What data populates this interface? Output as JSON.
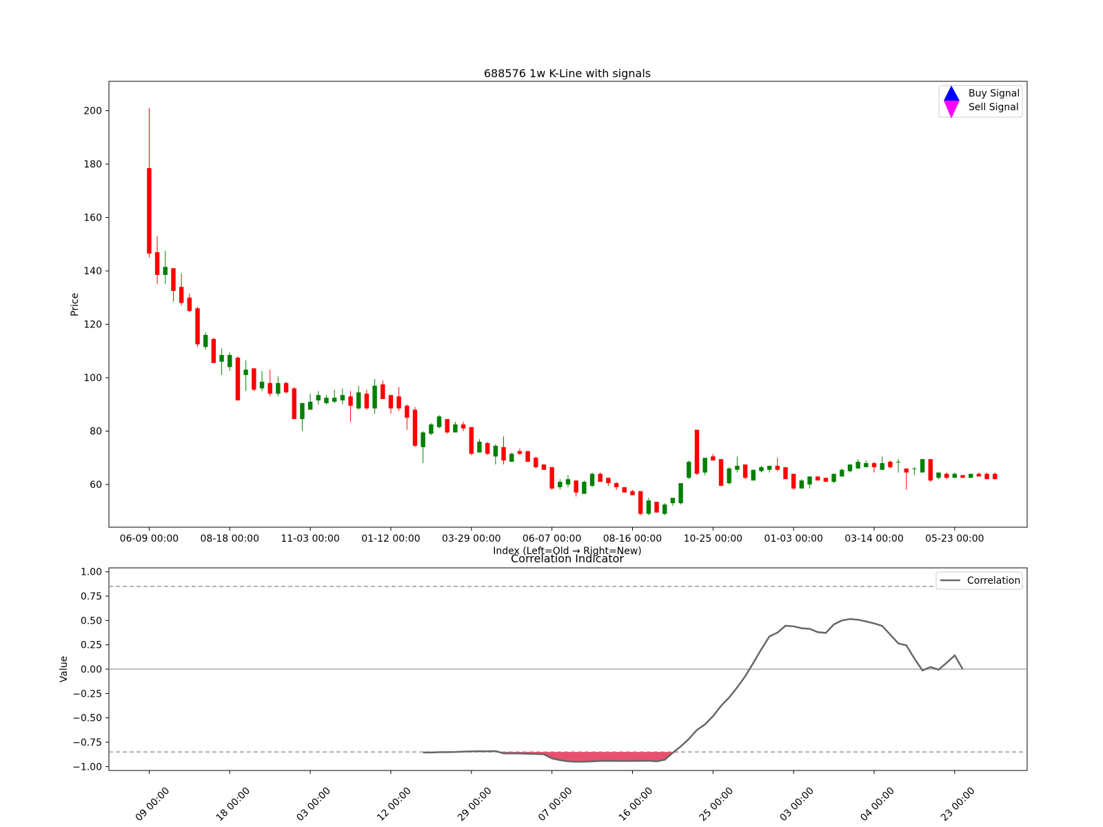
{
  "chart_data": [
    {
      "type": "candlestick",
      "title": "688576 1w K-Line with signals",
      "xlabel": "Index (Left=Old → Right=New)",
      "ylabel": "Price",
      "ylim": [
        44,
        211
      ],
      "yticks": [
        60,
        80,
        100,
        120,
        140,
        160,
        180,
        200
      ],
      "xtick_labels": [
        "06-09 00:00",
        "08-18 00:00",
        "11-03 00:00",
        "01-12 00:00",
        "03-29 00:00",
        "06-07 00:00",
        "08-16 00:00",
        "10-25 00:00",
        "01-03 00:00",
        "03-14 00:00",
        "05-23 00:00"
      ],
      "xtick_index_step": 10,
      "xlim_index": [
        -5,
        109
      ],
      "colors": {
        "up": "#ff0000",
        "down": "#008000",
        "buy": "#0000ff",
        "sell": "#ff00ff"
      },
      "legend": [
        "Buy Signal",
        "Sell Signal"
      ],
      "legend_position": "top-right",
      "candles": [
        [
          178.5,
          146.5,
          201,
          145
        ],
        [
          147,
          138.5,
          153,
          135
        ],
        [
          138.5,
          141.5,
          147.5,
          135
        ],
        [
          141,
          132.5,
          141,
          128.5
        ],
        [
          134,
          128,
          139,
          127
        ],
        [
          130,
          125,
          131.5,
          124.5
        ],
        [
          126,
          112.5,
          126.5,
          111.5
        ],
        [
          111.5,
          116,
          117,
          110.5
        ],
        [
          114.5,
          105.5,
          115,
          105.5
        ],
        [
          106,
          108.5,
          111,
          101
        ],
        [
          104,
          108.5,
          109.5,
          102.5
        ],
        [
          107.5,
          91.5,
          108,
          91.5
        ],
        [
          101,
          103,
          106.5,
          95
        ],
        [
          103.5,
          95.5,
          103.5,
          95
        ],
        [
          96,
          98.5,
          102.5,
          95
        ],
        [
          98,
          94,
          103,
          93
        ],
        [
          94,
          98,
          100.5,
          93
        ],
        [
          98,
          94.5,
          98.5,
          94
        ],
        [
          96,
          84.5,
          96.5,
          84.5
        ],
        [
          84.5,
          90.5,
          90.5,
          80
        ],
        [
          88,
          91,
          94,
          88
        ],
        [
          91.5,
          93.5,
          95,
          90
        ],
        [
          90.5,
          92.5,
          93.5,
          90
        ],
        [
          91,
          92.5,
          95.5,
          90.5
        ],
        [
          91.5,
          93.5,
          96,
          90
        ],
        [
          93,
          89.5,
          95,
          83.5
        ],
        [
          88.5,
          94.5,
          97,
          88
        ],
        [
          94,
          88.5,
          95.5,
          88
        ],
        [
          88.5,
          97,
          99.5,
          86.5
        ],
        [
          97.5,
          92,
          99,
          92
        ],
        [
          93.5,
          88.5,
          93.5,
          86.5
        ],
        [
          93,
          88.5,
          96.5,
          87.5
        ],
        [
          89.5,
          85,
          90,
          80.5
        ],
        [
          88,
          74.5,
          89,
          74
        ],
        [
          74,
          79.5,
          80,
          68
        ],
        [
          79,
          82.5,
          83,
          78.5
        ],
        [
          81.5,
          85.5,
          86,
          81
        ],
        [
          84.5,
          79.5,
          84.5,
          79
        ],
        [
          79.5,
          82.5,
          83.5,
          79.5
        ],
        [
          82.5,
          81,
          83.5,
          80
        ],
        [
          81.5,
          71.5,
          81.5,
          71
        ],
        [
          72,
          76,
          77,
          72
        ],
        [
          75.5,
          71.5,
          76,
          71
        ],
        [
          70.5,
          74.5,
          75,
          67.5
        ],
        [
          74,
          69,
          78,
          67.5
        ],
        [
          68.5,
          71.5,
          72,
          68.5
        ],
        [
          72.5,
          71.5,
          73.5,
          71
        ],
        [
          72.5,
          68.5,
          72.5,
          68.5
        ],
        [
          70,
          66.5,
          70.5,
          66
        ],
        [
          67.5,
          65.5,
          67.5,
          65.5
        ],
        [
          66.5,
          58.5,
          66.5,
          58
        ],
        [
          59,
          61,
          62,
          58
        ],
        [
          60,
          62,
          63.5,
          59
        ],
        [
          61.5,
          57,
          61.5,
          55.5
        ],
        [
          56.5,
          61,
          61.5,
          56.5
        ],
        [
          59.5,
          64,
          64.5,
          59
        ],
        [
          64,
          61,
          64.5,
          61
        ],
        [
          62.5,
          60.5,
          62.5,
          59.5
        ],
        [
          60.5,
          59,
          61,
          58
        ],
        [
          59,
          57,
          59,
          57
        ],
        [
          57.5,
          56,
          58,
          56
        ],
        [
          57.5,
          49,
          57.5,
          48.5
        ],
        [
          49,
          54,
          55,
          48.5
        ],
        [
          53.5,
          49.5,
          53.5,
          49.5
        ],
        [
          49,
          52.5,
          53,
          48.5
        ],
        [
          53,
          55,
          55,
          52
        ],
        [
          53,
          60.5,
          60.5,
          52.5
        ],
        [
          62.5,
          68.5,
          69,
          62
        ],
        [
          80.5,
          64,
          80.5,
          63.5
        ],
        [
          64.5,
          70,
          70,
          63.5
        ],
        [
          70.5,
          69,
          71.5,
          69
        ],
        [
          69.5,
          59.5,
          69.5,
          59.5
        ],
        [
          60.5,
          66,
          66.5,
          60
        ],
        [
          65.5,
          67,
          70.5,
          64.5
        ],
        [
          67.5,
          62.5,
          67.5,
          62
        ],
        [
          61.5,
          65.5,
          65.5,
          61.5
        ],
        [
          65,
          66.5,
          67,
          64.5
        ],
        [
          65.5,
          67,
          67,
          64.5
        ],
        [
          67,
          65.5,
          70,
          65
        ],
        [
          66.5,
          62,
          66.5,
          62
        ],
        [
          64,
          58.5,
          64,
          58
        ],
        [
          58.5,
          61.5,
          62,
          58.5
        ],
        [
          60,
          63,
          63,
          58.5
        ],
        [
          63,
          61.5,
          63,
          61.5
        ],
        [
          62.5,
          61,
          62.5,
          61
        ],
        [
          61,
          64,
          64,
          60.5
        ],
        [
          63,
          65.5,
          66,
          63
        ],
        [
          65,
          67.5,
          67.5,
          64.5
        ],
        [
          66,
          68.5,
          69.5,
          66
        ],
        [
          66.5,
          68,
          69,
          66.5
        ],
        [
          68,
          66.5,
          68.5,
          64.5
        ],
        [
          65.5,
          68,
          70.5,
          65.5
        ],
        [
          68.5,
          66.5,
          69,
          66
        ],
        [
          68.5,
          68.5,
          69.5,
          64.5
        ],
        [
          66,
          64.5,
          66,
          58
        ],
        [
          66,
          66,
          66.5,
          63.5
        ],
        [
          64.5,
          69.5,
          69.5,
          64.5
        ],
        [
          69.5,
          61.5,
          69.5,
          61
        ],
        [
          62.5,
          64.5,
          64.5,
          62
        ],
        [
          64,
          62.5,
          64.5,
          62
        ],
        [
          62.5,
          64,
          64.5,
          62.5
        ],
        [
          63.5,
          62.5,
          63.5,
          62.5
        ],
        [
          62.5,
          64,
          64,
          62.5
        ],
        [
          64,
          63,
          64.5,
          63
        ],
        [
          64,
          62,
          64.5,
          62
        ],
        [
          64,
          62,
          64.5,
          62
        ]
      ]
    },
    {
      "type": "line",
      "title": "Correlation Indicator",
      "ylabel": "Value",
      "ylim": [
        -1.04,
        1.04
      ],
      "yticks": [
        -1.0,
        -0.75,
        -0.5,
        -0.25,
        0.0,
        0.25,
        0.5,
        0.75,
        1.0
      ],
      "ytick_labels": [
        "−1.00",
        "−0.75",
        "−0.50",
        "−0.25",
        "0.00",
        "0.25",
        "0.50",
        "0.75",
        "1.00"
      ],
      "xtick_labels_partial": [
        "09 00:00",
        "18 00:00",
        "03 00:00",
        "12 00:00",
        "29 00:00",
        "07 00:00",
        "16 00:00",
        "25 00:00",
        "03 00:00",
        "04 00:00",
        "23 00:00"
      ],
      "legend": [
        "Correlation"
      ],
      "legend_position": "top-right",
      "thresholds": [
        0.85,
        -0.85
      ],
      "colors": {
        "line": "#666666",
        "threshold": "#999999",
        "zero": "#aaaaaa",
        "fill": "#e8516e"
      },
      "x_start_index": 34,
      "series": [
        {
          "name": "Correlation",
          "values": [
            -0.855,
            -0.855,
            -0.852,
            -0.852,
            -0.85,
            -0.846,
            -0.844,
            -0.842,
            -0.843,
            -0.841,
            -0.864,
            -0.865,
            -0.866,
            -0.868,
            -0.87,
            -0.874,
            -0.916,
            -0.934,
            -0.946,
            -0.951,
            -0.95,
            -0.946,
            -0.942,
            -0.941,
            -0.942,
            -0.943,
            -0.942,
            -0.942,
            -0.94,
            -0.946,
            -0.93,
            -0.858,
            -0.793,
            -0.716,
            -0.624,
            -0.567,
            -0.482,
            -0.376,
            -0.291,
            -0.187,
            -0.072,
            0.064,
            0.205,
            0.336,
            0.375,
            0.446,
            0.44,
            0.42,
            0.414,
            0.38,
            0.372,
            0.46,
            0.5,
            0.515,
            0.508,
            0.49,
            0.47,
            0.444,
            0.355,
            0.265,
            0.245,
            0.109,
            -0.013,
            0.022,
            -0.005,
            0.065,
            0.142,
            0.0
          ]
        }
      ]
    }
  ]
}
